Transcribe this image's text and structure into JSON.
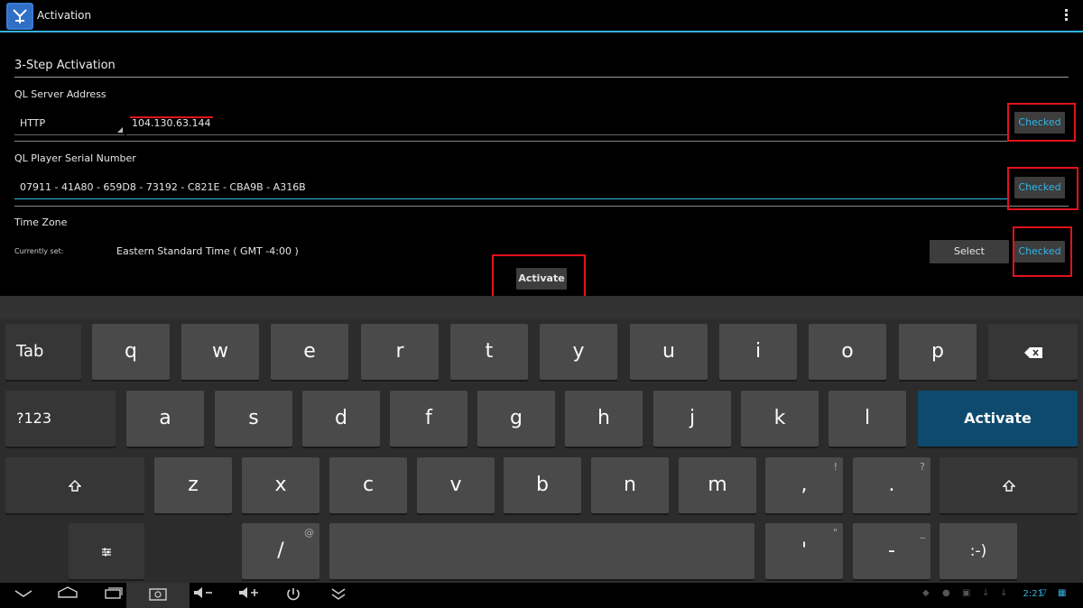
{
  "app": {
    "title": "Activation"
  },
  "form": {
    "section_title": "3-Step Activation",
    "server": {
      "label": "QL Server Address",
      "protocol": "HTTP",
      "address": "104.130.63.144",
      "status": "Checked"
    },
    "serial": {
      "label": "QL Player Serial Number",
      "value": "07911 - 41A80 - 659D8 - 73192 - C821E - CBA9B - A316B",
      "status": "Checked"
    },
    "timezone": {
      "label": "Time Zone",
      "current_label": "Currently set:",
      "value": "Eastern Standard Time ( GMT -4:00 )",
      "select_label": "Select",
      "status": "Checked"
    },
    "activate_label": "Activate"
  },
  "keyboard": {
    "row1": [
      "Tab",
      "q",
      "w",
      "e",
      "r",
      "t",
      "y",
      "u",
      "i",
      "o",
      "p"
    ],
    "row2": [
      "?123",
      "a",
      "s",
      "d",
      "f",
      "g",
      "h",
      "j",
      "k",
      "l"
    ],
    "enter_label": "Activate",
    "row3": [
      "z",
      "x",
      "c",
      "v",
      "b",
      "n",
      "m",
      ",",
      "."
    ],
    "row3_hints": [
      "!",
      "?"
    ],
    "row4": [
      "/",
      "'",
      "-",
      ":-)"
    ],
    "row4_hints": [
      "@",
      "\"",
      "_"
    ],
    "icons": [
      "backspace-icon",
      "shift-icon",
      "settings-icon"
    ]
  },
  "statusbar": {
    "time": "2:21"
  },
  "colors": {
    "accent": "#33b5e5",
    "annotation": "#e2121b",
    "enter_key": "#0d4a6e"
  }
}
